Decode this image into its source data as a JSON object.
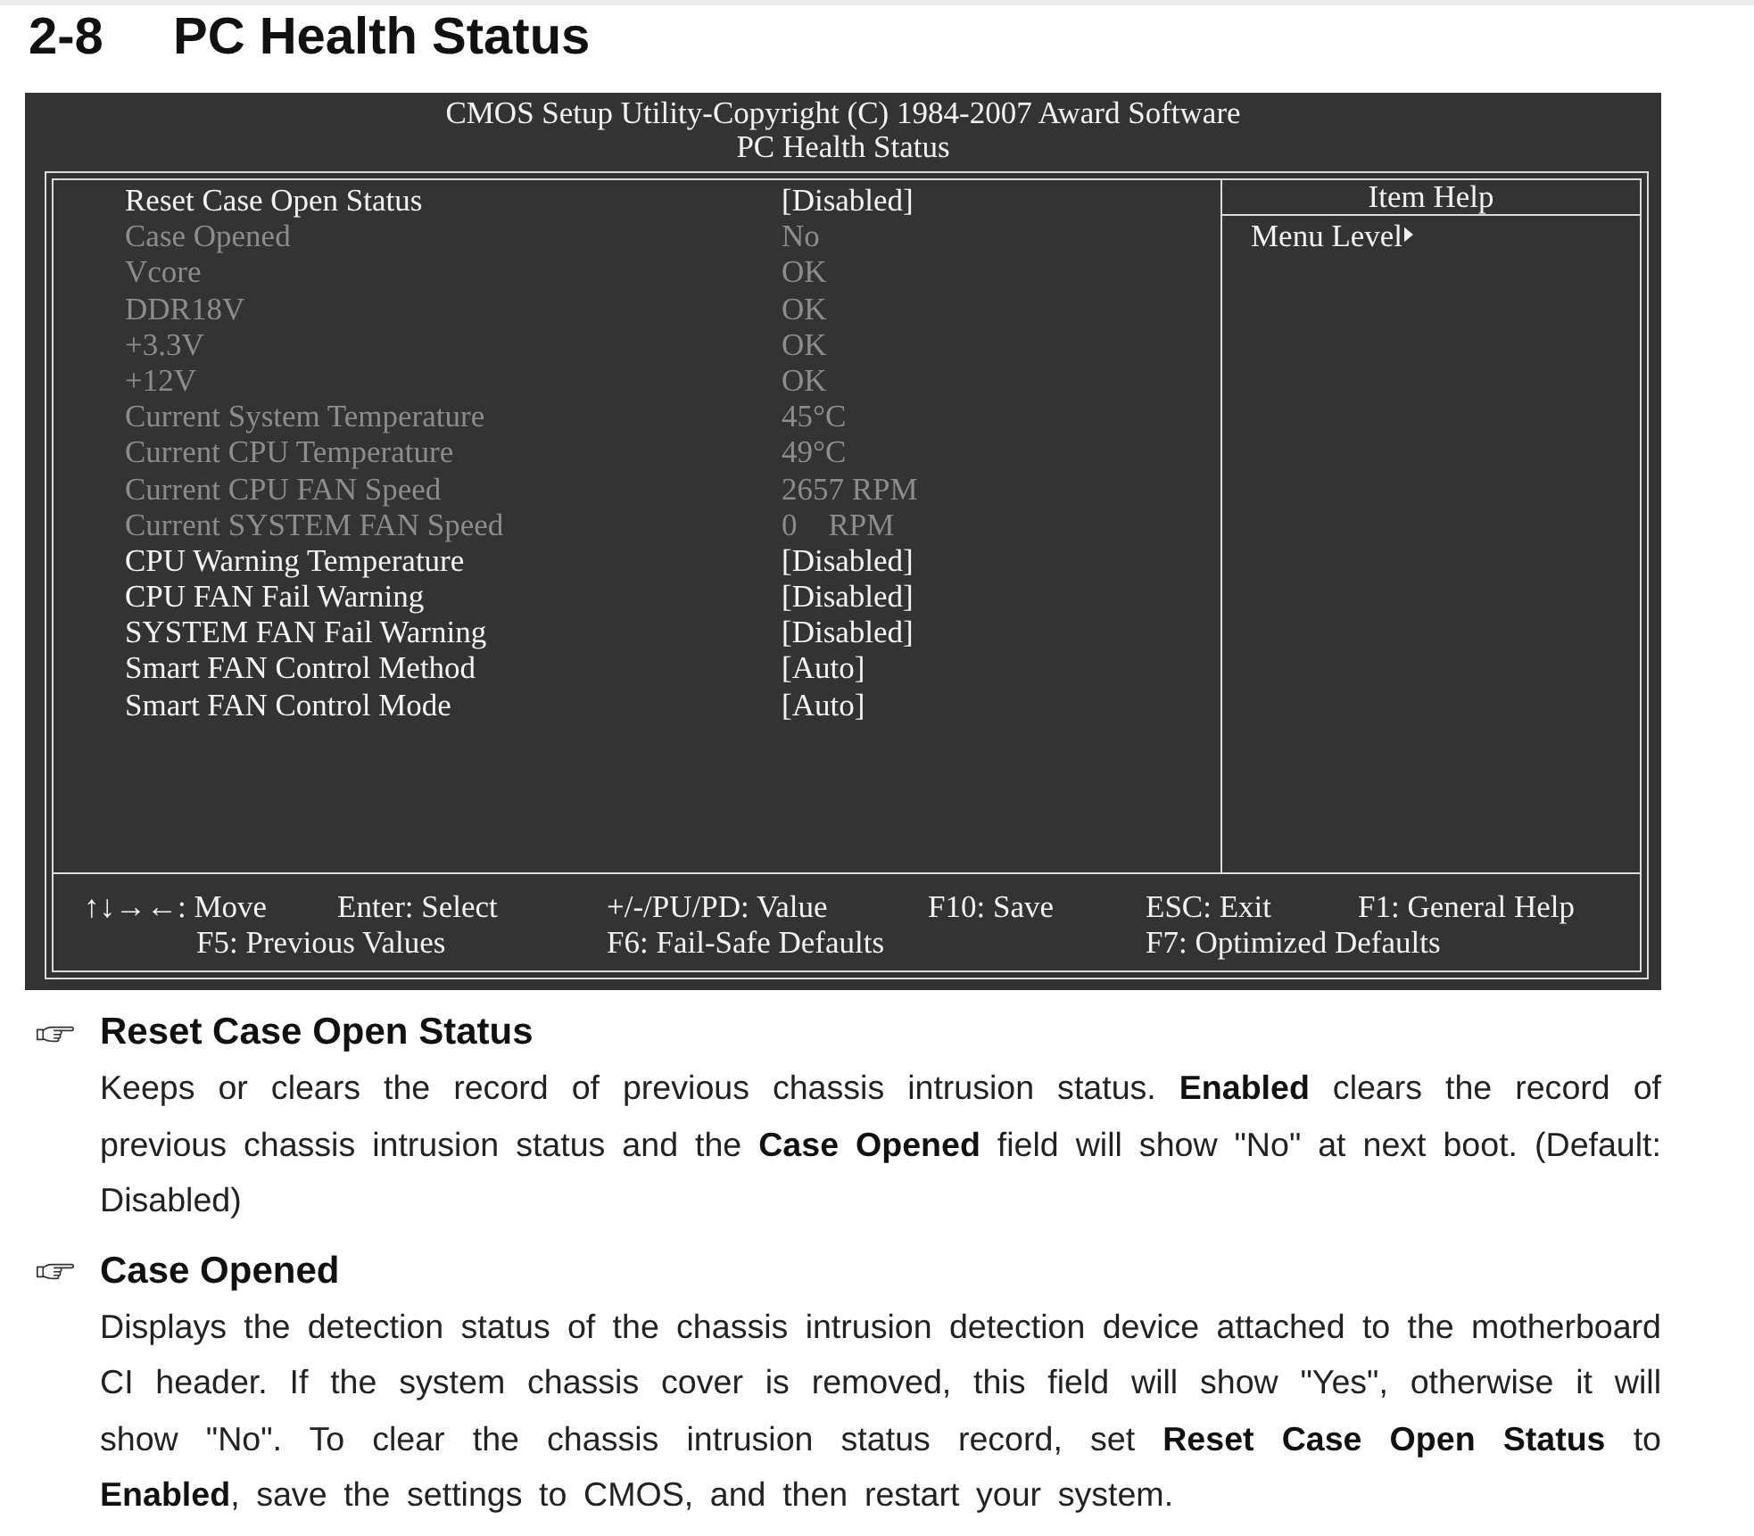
{
  "heading": {
    "number": "2-8",
    "title": "PC Health Status"
  },
  "bios": {
    "title": "CMOS Setup Utility-Copyright (C) 1984-2007 Award Software",
    "subtitle": "PC Health Status",
    "settings": [
      {
        "label": "Reset Case Open Status",
        "value": "[Disabled]",
        "disabled": false
      },
      {
        "label": "Case Opened",
        "value": "No",
        "disabled": true
      },
      {
        "label": "Vcore",
        "value": "OK",
        "disabled": true
      },
      {
        "label": "DDR18V",
        "value": "OK",
        "disabled": true
      },
      {
        "label": "+3.3V",
        "value": "OK",
        "disabled": true
      },
      {
        "label": "+12V",
        "value": "OK",
        "disabled": true
      },
      {
        "label": "Current System Temperature",
        "value": "45°C",
        "disabled": true
      },
      {
        "label": "Current CPU Temperature",
        "value": "49°C",
        "disabled": true
      },
      {
        "label": "Current CPU FAN Speed",
        "value": "2657 RPM",
        "disabled": true
      },
      {
        "label": "Current SYSTEM FAN Speed",
        "value": "0    RPM",
        "disabled": true
      },
      {
        "label": "CPU Warning Temperature",
        "value": "[Disabled]",
        "disabled": false
      },
      {
        "label": "CPU FAN Fail Warning",
        "value": "[Disabled]",
        "disabled": false
      },
      {
        "label": "SYSTEM FAN Fail Warning",
        "value": "[Disabled]",
        "disabled": false
      },
      {
        "label": "Smart FAN Control Method",
        "value": "[Auto]",
        "disabled": false
      },
      {
        "label": "Smart FAN Control Mode",
        "value": "[Auto]",
        "disabled": false
      }
    ],
    "item_help": {
      "title": "Item Help",
      "menu_level": "Menu Level"
    },
    "key_legend": [
      [
        "↑↓→←: Move",
        "Enter: Select",
        "+/-/PU/PD: Value",
        "F10: Save",
        "ESC: Exit",
        "F1: General Help"
      ],
      [
        "F5: Previous Values",
        "F6: Fail-Safe Defaults",
        "F7: Optimized Defaults"
      ]
    ]
  },
  "sections": [
    {
      "heading": "Reset Case Open Status",
      "body": "Keeps or clears the record of previous chassis intrusion status. **Enabled** clears the record of previous chassis intrusion status and the **Case Opened** field will show \"No\" at next boot. (Default: Disabled)"
    },
    {
      "heading": "Case Opened",
      "body": "Displays the detection status of the chassis intrusion detection device attached to the motherboard CI header. If the system chassis cover is removed, this field will show \"Yes\", otherwise it will show \"No\". To clear the chassis intrusion status record, set **Reset Case Open Status** to **Enabled**, save the settings to CMOS, and then restart your system."
    }
  ]
}
